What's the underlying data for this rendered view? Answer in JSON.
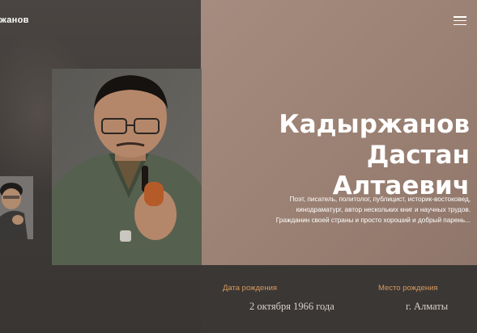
{
  "header": {
    "logo_text": "жанов",
    "menu_icon": "hamburger-icon"
  },
  "hero": {
    "name_line1": "Кадыржанов Дастан",
    "name_line2": "Алтаевич",
    "bio_line1": "Поэт, писатель, политолог, публицист, историк-востоковед,",
    "bio_line2": "кинодраматург, автор нескольких книг и научных трудов.",
    "bio_line3": "Гражданин своей страны и просто хороший и добрый парень..."
  },
  "facts": {
    "birth_label": "Дата рождения",
    "birth_value": "2 октября 1966 года",
    "place_label": "Место рождения",
    "place_value": "г. Алматы"
  },
  "colors": {
    "accent": "#d79a5c",
    "panel": "#9b8173",
    "dark": "#3b3735"
  }
}
